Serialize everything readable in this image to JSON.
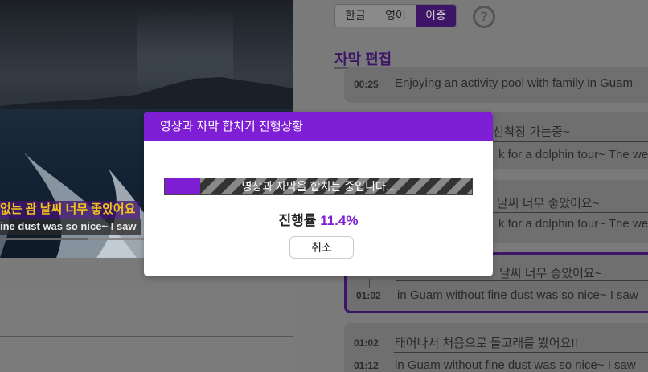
{
  "video": {
    "subtitle_korean": "없는 괌 날씨 너무 좋았어요",
    "subtitle_english": "ine dust was so nice~ I saw"
  },
  "lang_tabs": {
    "items": [
      "한글",
      "영어",
      "이중"
    ],
    "selected": "이중"
  },
  "help_icon": "?",
  "editor": {
    "title": "자막 편집",
    "entries": [
      {
        "time_start": "00:25",
        "text_ko": "",
        "text_en": "Enjoying an activity pool with family in Guam"
      },
      {
        "time_start": "",
        "text_ko": "선착장 가는중~",
        "text_en": "k for a dolphin tour~ The we"
      },
      {
        "time_start": "",
        "text_ko": "날씨 너무 좋았어요~",
        "text_en": "k for a dolphin tour~ The we"
      },
      {
        "time_start": "01:02",
        "text_ko": "날씨 너무 좋았어요~",
        "text_en": "in Guam without fine dust was so nice~ I saw",
        "selected": true
      },
      {
        "time_start": "01:02",
        "time_end": "01:12",
        "text_ko": "태어나서 처음으로 돌고래를 봤어요!!",
        "text_en": "in Guam without fine dust was so nice~ I saw"
      }
    ]
  },
  "modal": {
    "title": "영상과 자막 합치기 진행상황",
    "bar_label": "영상과 자막을 합치는 중입니다...",
    "progress_label": "진행률",
    "progress_percent": "11.4%",
    "progress_value": 0.114,
    "cancel_label": "취소"
  },
  "colors": {
    "accent": "#7e1fd6",
    "dark_accent": "#3d1568",
    "subtitle_yellow": "#f2c31c"
  }
}
